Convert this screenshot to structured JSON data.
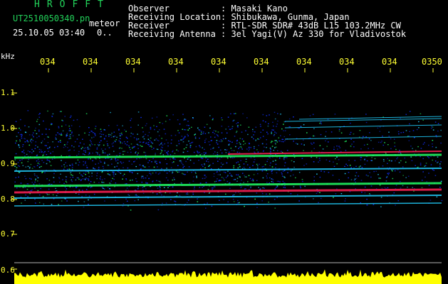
{
  "header": {
    "brand": "HROFFT",
    "filename": "UT2510050340.pn",
    "filename_suffix": "meteor",
    "datetime": "25.10.05 03:40",
    "extra_value": "0..",
    "meta": [
      {
        "key": "Observer",
        "value": ": Masaki Kano"
      },
      {
        "key": "Receiving Location",
        "value": ": Shibukawa, Gunma, Japan"
      },
      {
        "key": "Receiver",
        "value": ": RTL-SDR SDR# 43dB L15 103.2MHz CW"
      },
      {
        "key": "Receiving Antenna",
        "value": ": 3el Yagi(V) Az 330 for Vladivostok"
      }
    ]
  },
  "axis": {
    "unit": "kHz",
    "x_ticks": [
      "034",
      "034",
      "034",
      "034",
      "034",
      "034",
      "034",
      "034",
      "034",
      "0350"
    ],
    "y_labels": [
      "1.1",
      "1.0",
      "0.9",
      "0.8",
      "0.7",
      "0.6"
    ]
  },
  "colors": {
    "header_green": "#22d35a",
    "tick_yellow": "#ffff33",
    "echo_blue": "#1030ff",
    "echo_cyan": "#22d0ff",
    "echo_green": "#22ff66",
    "echo_red": "#ff2255",
    "signal_yellow": "#ffff00"
  }
}
